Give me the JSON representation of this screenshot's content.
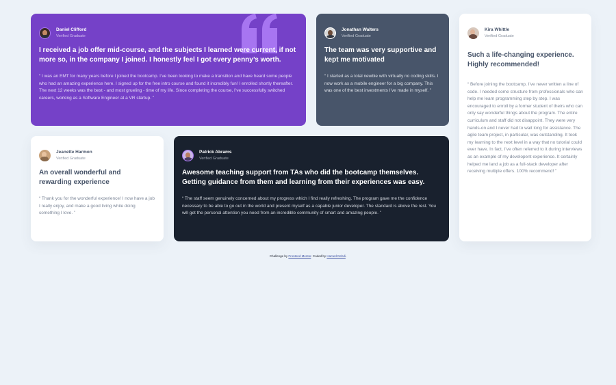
{
  "testimonials": {
    "daniel": {
      "name": "Daniel Clifford",
      "role": "Verified Graduate",
      "headline": "I received a job offer mid-course, and the subjects I learned were current, if not more so, in the company I joined. I honestly feel I got every penny’s worth.",
      "quote": "“ I was an EMT for many years before I joined the bootcamp. I’ve been looking to make a transition and have heard some people who had an amazing experience here. I signed up for the free intro course and found it incredibly fun! I enrolled shortly thereafter. The next 12 weeks was the best - and most grueling - time of my life. Since completing the course, I’ve successfully switched careers, working as a Software Engineer at a VR startup. ”",
      "bg_color": "#7541c8"
    },
    "jonathan": {
      "name": "Jonathan Walters",
      "role": "Verified Graduate",
      "headline": "The team was very supportive and kept me motivated",
      "quote": "“ I started as a total newbie with virtually no coding skills. I now work as a mobile engineer for a big company. This was one of the best investments I’ve made in myself. ”",
      "bg_color": "#48556a"
    },
    "kira": {
      "name": "Kira Whittle",
      "role": "Verified Graduate",
      "headline": "Such a life-changing experience. Highly recommended!",
      "quote": "“ Before joining the bootcamp, I’ve never written a line of code. I needed some structure from professionals who can help me learn programming step by step. I was encouraged to enroll by a former student of theirs who can only say wonderful things about the program. The entire curriculum and staff did not disappoint. They were very hands-on and I never had to wait long for assistance. The agile team project, in particular, was outstanding. It took my learning to the next level in a way that no tutorial could ever have. In fact, I’ve often referred to it during interviews as an example of my developent experience. It certainly helped me land a job as a full-stack developer after receiving multiple offers. 100% recommend! ”",
      "bg_color": "#ffffff"
    },
    "jeanette": {
      "name": "Jeanette Harmon",
      "role": "Verified Graduate",
      "headline": "An overall wonderful and rewarding experience",
      "quote": "“ Thank you for the wonderful experience! I now have a job I really enjoy, and make a good living while doing something I love. ”",
      "bg_color": "#ffffff"
    },
    "patrick": {
      "name": "Patrick Abrams",
      "role": "Verified Graduate",
      "headline": "Awesome teaching support from TAs who did the bootcamp themselves. Getting guidance from them and learning from their experiences was easy.",
      "quote": "“ The staff seem genuinely concerned about my progress which I find really refreshing. The program gave me the confidence necessary to be able to go out in the world and present myself as a capable junior developer. The standard is above the rest. You will get the personal attention you need from an incredible community of smart and amazing people. ”",
      "bg_color": "#19212e"
    }
  },
  "attribution": {
    "prefix": "Challenge by ",
    "link1": "Frontend Mentor",
    "middle": ". Coded by ",
    "link2": "Hamed Dehdi",
    "suffix": "."
  },
  "colors": {
    "page_bg": "#ecf2f8",
    "quote_mark": "#a775f1"
  }
}
